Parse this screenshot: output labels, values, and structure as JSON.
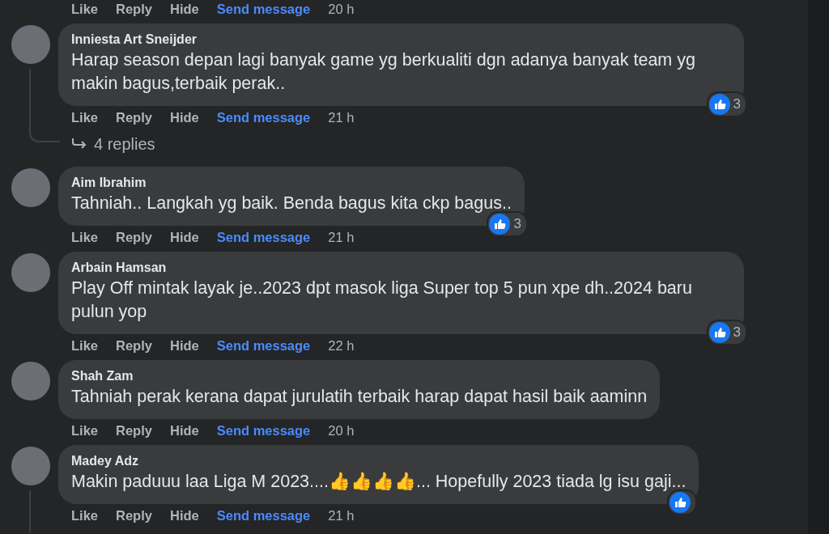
{
  "top_actions": {
    "actions": [
      {
        "label": "Like",
        "kind": "plain"
      },
      {
        "label": "Reply",
        "kind": "plain"
      },
      {
        "label": "Hide",
        "kind": "plain"
      },
      {
        "label": "Send message",
        "kind": "accent"
      }
    ],
    "time": "20 h"
  },
  "comments": [
    {
      "author": "Inniesta Art Sneijder",
      "text": "Harap season depan lagi banyak game yg berkualiti dgn adanya banyak team yg makin bagus,terbaik perak..",
      "actions": [
        {
          "label": "Like",
          "kind": "plain"
        },
        {
          "label": "Reply",
          "kind": "plain"
        },
        {
          "label": "Hide",
          "kind": "plain"
        },
        {
          "label": "Send message",
          "kind": "accent"
        }
      ],
      "time": "21 h",
      "liked": true,
      "reaction_count": "3",
      "replies": "4 replies",
      "thread": true
    },
    {
      "author": "Aim Ibrahim",
      "text": "Tahniah.. Langkah yg baik. Benda bagus kita ckp bagus..",
      "actions": [
        {
          "label": "Like",
          "kind": "plain"
        },
        {
          "label": "Reply",
          "kind": "plain"
        },
        {
          "label": "Hide",
          "kind": "plain"
        },
        {
          "label": "Send message",
          "kind": "accent"
        }
      ],
      "time": "21 h",
      "liked": true,
      "reaction_count": "3",
      "thread": false
    },
    {
      "author": "Arbain Hamsan",
      "text": "Play Off mintak layak je..2023 dpt masok liga Super top 5 pun xpe dh..2024 baru pulun yop",
      "actions": [
        {
          "label": "Like",
          "kind": "plain"
        },
        {
          "label": "Reply",
          "kind": "plain"
        },
        {
          "label": "Hide",
          "kind": "plain"
        },
        {
          "label": "Send message",
          "kind": "accent"
        }
      ],
      "time": "22 h",
      "liked": true,
      "reaction_count": "3",
      "thread": false
    },
    {
      "author": "Shah Zam",
      "text": "Tahniah perak kerana dapat jurulatih terbaik harap dapat hasil baik aaminn",
      "actions": [
        {
          "label": "Like",
          "kind": "plain"
        },
        {
          "label": "Reply",
          "kind": "plain"
        },
        {
          "label": "Hide",
          "kind": "plain"
        },
        {
          "label": "Send message",
          "kind": "accent"
        }
      ],
      "time": "20 h",
      "liked": false,
      "thread": false
    },
    {
      "author": "Madey Adz",
      "text": "Makin paduuu laa Liga M 2023....👍👍👍👍... Hopefully 2023 tiada lg isu gaji...",
      "actions": [
        {
          "label": "Like",
          "kind": "plain"
        },
        {
          "label": "Reply",
          "kind": "plain"
        },
        {
          "label": "Hide",
          "kind": "plain"
        },
        {
          "label": "Send message",
          "kind": "accent"
        }
      ],
      "time": "21 h",
      "liked": true,
      "thread": true
    }
  ]
}
